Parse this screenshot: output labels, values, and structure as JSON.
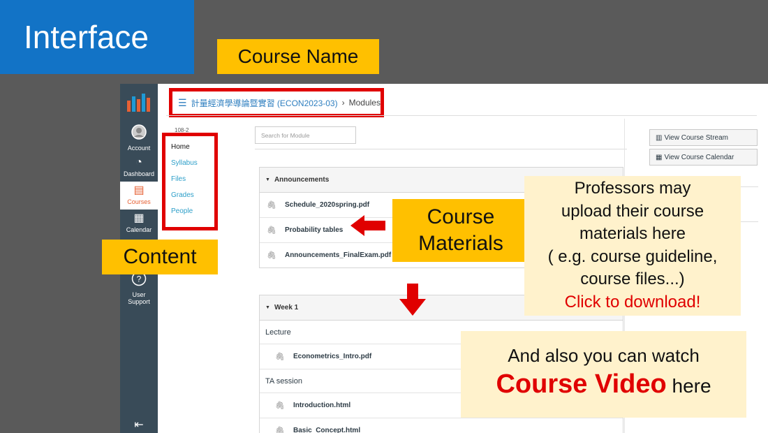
{
  "slide": {
    "title": "Interface",
    "labels": {
      "course_name": "Course Name",
      "content": "Content",
      "course_materials": "Course Materials"
    },
    "note_upload": {
      "line1": "Professors may",
      "line2": "upload their course",
      "line3": "materials here",
      "line4": "( e.g. course guideline,",
      "line5": "course files...)",
      "cta": "Click to download!"
    },
    "note_video": {
      "line1": "And also you can watch",
      "highlight": "Course Video",
      "suffix": " here"
    }
  },
  "global_nav": {
    "items": [
      {
        "label": "Account",
        "icon": "account-icon"
      },
      {
        "label": "Dashboard",
        "icon": "dashboard-icon"
      },
      {
        "label": "Courses",
        "icon": "courses-icon"
      },
      {
        "label": "Calendar",
        "icon": "calendar-icon"
      },
      {
        "label": "User Support",
        "icon": "help-icon"
      }
    ]
  },
  "breadcrumb": {
    "course": "計量經濟學導論暨實習 (ECON2023-03)",
    "separator": "›",
    "page": "Modules"
  },
  "course_nav": {
    "term": "108-2",
    "items": [
      "Home",
      "Syllabus",
      "Files",
      "Grades",
      "People"
    ]
  },
  "search": {
    "placeholder": "Search for Module"
  },
  "modules": [
    {
      "name": "Announcements",
      "items": [
        "Schedule_2020spring.pdf",
        "Probability tables",
        "Announcements_FinalExam.pdf"
      ]
    },
    {
      "name": "Week 1",
      "subheaders": [
        "Lecture",
        "TA session"
      ],
      "items": [
        "Econometrics_Intro.pdf",
        "Introduction.html",
        "Basic_Concept.html"
      ]
    }
  ],
  "sidebar_buttons": {
    "stream": "View Course Stream",
    "calendar": "View Course Calendar"
  },
  "colors": {
    "title_bg": "#1273c6",
    "label_bg": "#ffc000",
    "highlight_red": "#e00000",
    "note_bg": "#fff2cc",
    "nav_bg": "#394b58",
    "link_blue": "#2d9fc9"
  }
}
